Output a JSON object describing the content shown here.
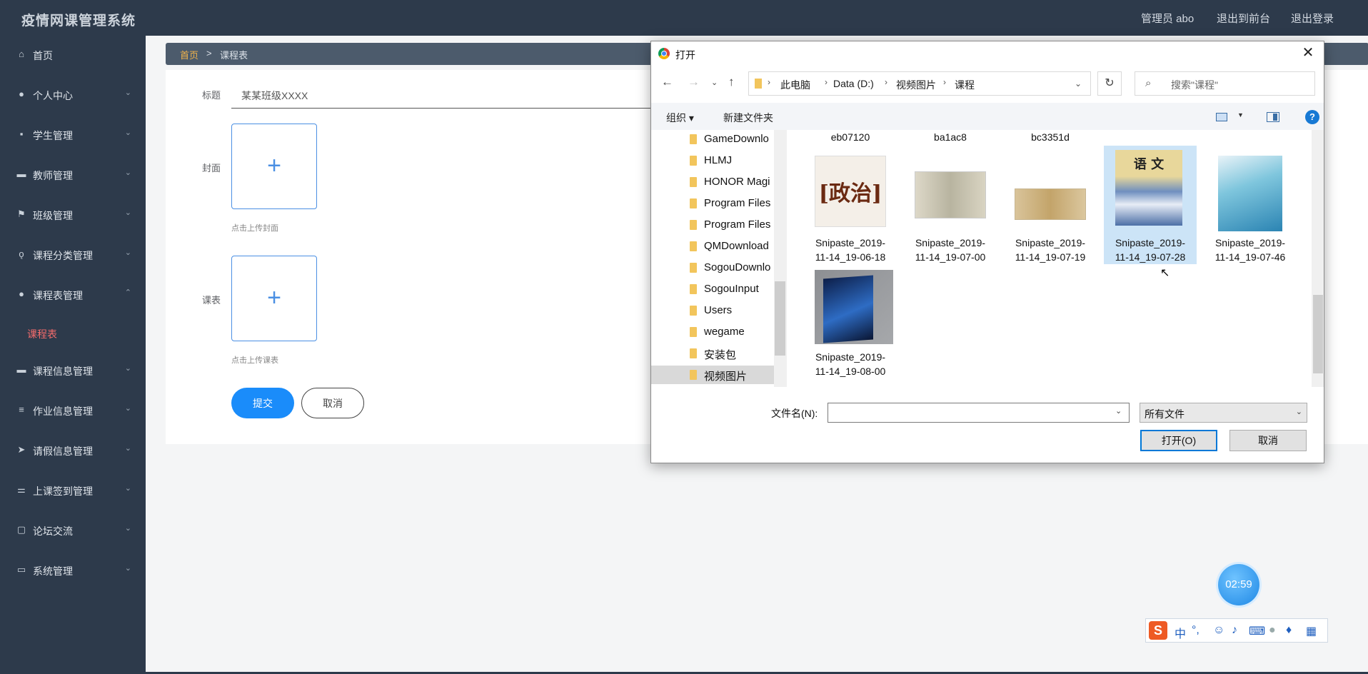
{
  "header": {
    "app_title": "疫情网课管理系统",
    "admin": "管理员 abo",
    "to_front": "退出到前台",
    "logout": "退出登录"
  },
  "sidebar": {
    "items": [
      {
        "label": "首页",
        "icon": "home-icon"
      },
      {
        "label": "个人中心",
        "icon": "user-icon"
      },
      {
        "label": "学生管理",
        "icon": "chat-icon"
      },
      {
        "label": "教师管理",
        "icon": "briefcase-icon"
      },
      {
        "label": "班级管理",
        "icon": "flag-icon"
      },
      {
        "label": "课程分类管理",
        "icon": "microphone-icon"
      },
      {
        "label": "课程表管理",
        "icon": "user-icon"
      },
      {
        "label": "课程信息管理",
        "icon": "briefcase-icon"
      },
      {
        "label": "作业信息管理",
        "icon": "menu-icon"
      },
      {
        "label": "请假信息管理",
        "icon": "send-icon"
      },
      {
        "label": "上课签到管理",
        "icon": "sliders-icon"
      },
      {
        "label": "论坛交流",
        "icon": "comment-icon"
      },
      {
        "label": "系统管理",
        "icon": "monitor-icon"
      }
    ],
    "sub_active": "课程表"
  },
  "breadcrumb": {
    "home": "首页",
    "sep": ">",
    "current": "课程表"
  },
  "form": {
    "title_label": "标题",
    "title_value": "某某班级XXXX",
    "cover_label": "封面",
    "cover_tip": "点击上传封面",
    "schedule_label": "课表",
    "schedule_tip": "点击上传课表",
    "submit": "提交",
    "cancel": "取消",
    "plus": "+"
  },
  "dialog": {
    "title": "打开",
    "close": "✕",
    "path": [
      "此电脑",
      "Data (D:)",
      "视频图片",
      "课程"
    ],
    "search_placeholder": "搜索\"课程\"",
    "toolbar": {
      "organize": "组织 ▾",
      "new_folder": "新建文件夹",
      "help": "?"
    },
    "tree": [
      "GameDownlo",
      "HLMJ",
      "HONOR Magi",
      "Program Files",
      "Program Files",
      "QMDownload",
      "SogouDownlo",
      "SogouInput",
      "Users",
      "wegame",
      "安装包",
      "视频图片"
    ],
    "partial_names": [
      "eb07120",
      "ba1ac8",
      "bc3351d"
    ],
    "files": [
      {
        "line1": "Snipaste_2019-",
        "line2": "11-14_19-06-18"
      },
      {
        "line1": "Snipaste_2019-",
        "line2": "11-14_19-07-00"
      },
      {
        "line1": "Snipaste_2019-",
        "line2": "11-14_19-07-19"
      },
      {
        "line1": "Snipaste_2019-",
        "line2": "11-14_19-07-28"
      },
      {
        "line1": "Snipaste_2019-",
        "line2": "11-14_19-07-46"
      },
      {
        "line1": "Snipaste_2019-",
        "line2": "11-14_19-08-00"
      }
    ],
    "thumb_text": {
      "politics": "[政治]",
      "chinese": "语 文"
    },
    "filename_label": "文件名(N):",
    "filetype": "所有文件",
    "open_button": "打开(O)",
    "cancel_button": "取消"
  },
  "timer": "02:59",
  "ime": {
    "logo": "S",
    "lang": "中",
    "punct": "°,"
  }
}
